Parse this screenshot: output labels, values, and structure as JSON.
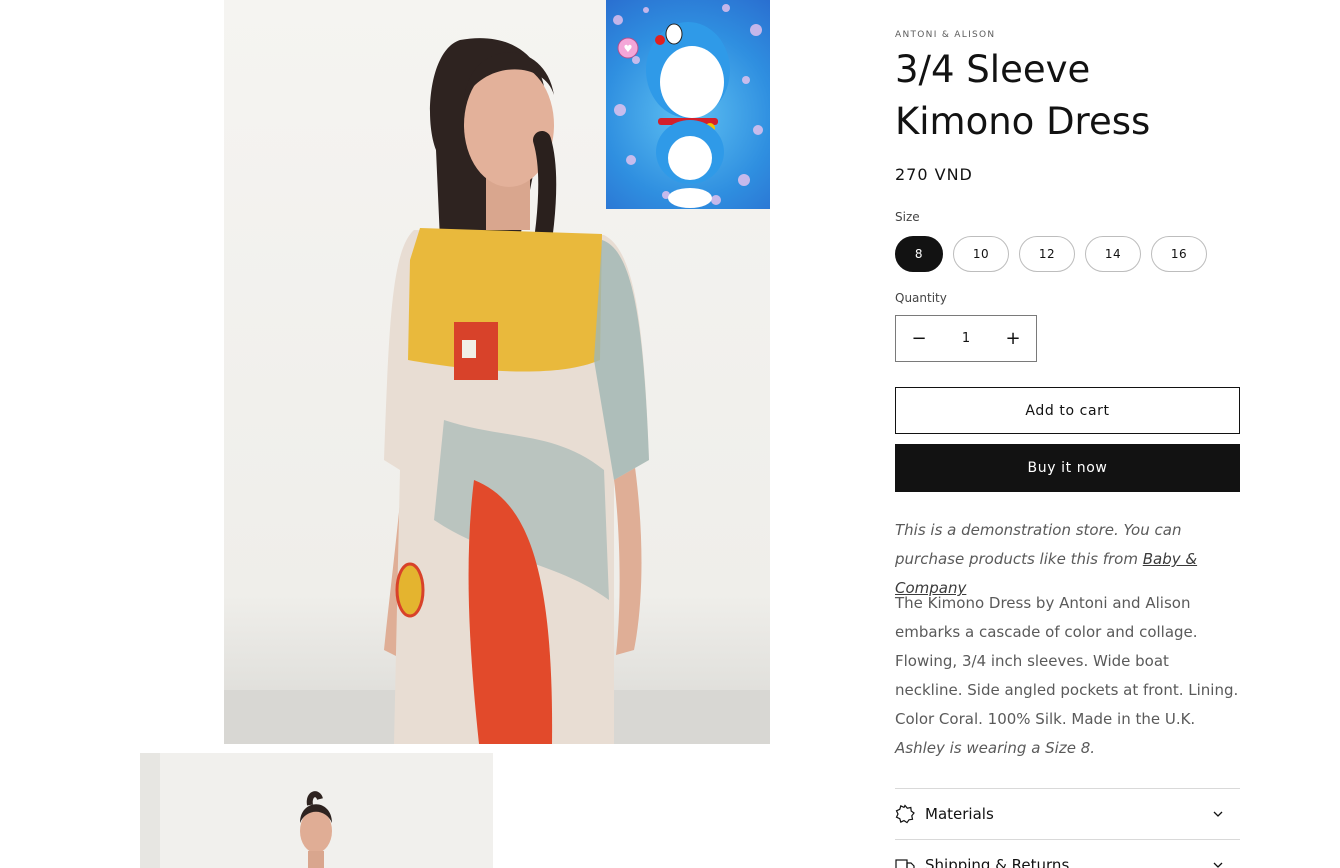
{
  "product": {
    "vendor": "ANTONI & ALISON",
    "title": "3/4 Sleeve Kimono Dress",
    "price": "270 VND"
  },
  "size": {
    "label": "Size",
    "options": [
      "8",
      "10",
      "12",
      "14",
      "16"
    ],
    "selected": "8"
  },
  "quantity": {
    "label": "Quantity",
    "value": "1",
    "decrease_symbol": "−",
    "increase_symbol": "+"
  },
  "buttons": {
    "add_to_cart": "Add to cart",
    "buy_now": "Buy it now"
  },
  "demo_note": {
    "text": "This is a demonstration store. You can purchase products like this from ",
    "link_text": "Baby & Company"
  },
  "description": {
    "text": "The Kimono Dress by Antoni and Alison embarks a cascade of color and collage. Flowing, 3/4 inch sleeves. Wide boat neckline. Side angled pockets at front. Lining. Color Coral. 100% Silk. Made in the U.K. ",
    "italic": "Ashley is wearing a Size 8."
  },
  "accordions": [
    {
      "label": "Materials",
      "icon": "fabric-icon"
    },
    {
      "label": "Shipping & Returns",
      "icon": "truck-icon"
    }
  ],
  "colors": {
    "text": "#121212",
    "muted": "#5a5a5a",
    "button_dark": "#121212",
    "border": "#d9d9d9"
  }
}
